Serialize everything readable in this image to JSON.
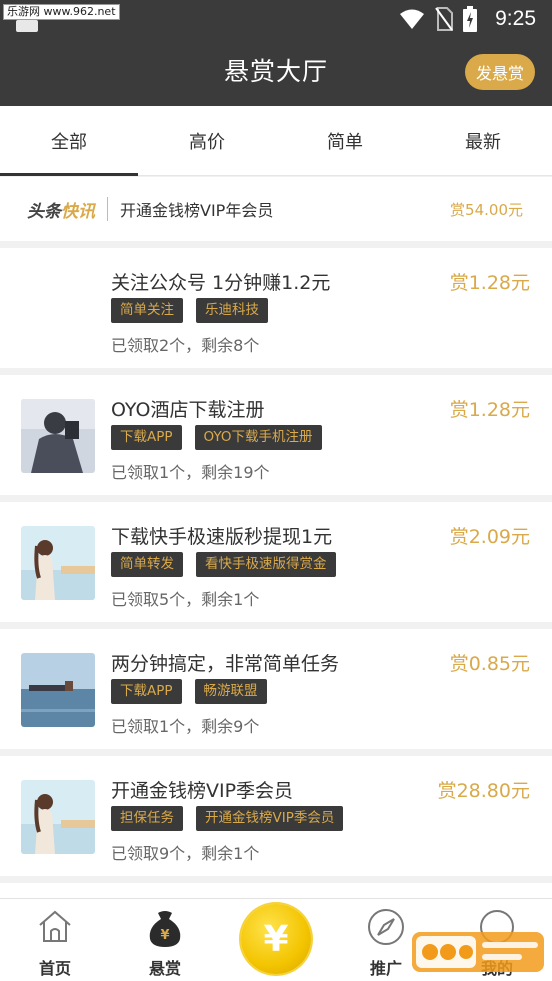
{
  "status_bar": {
    "watermark": "乐游网 www.962.net",
    "time": "9:25"
  },
  "header": {
    "title": "悬赏大厅",
    "post_button": "发悬赏"
  },
  "tabs": [
    {
      "label": "全部",
      "active": true
    },
    {
      "label": "高价",
      "active": false
    },
    {
      "label": "简单",
      "active": false
    },
    {
      "label": "最新",
      "active": false
    }
  ],
  "headline": {
    "logo_part1": "头条",
    "logo_part2": "快讯",
    "text": "开通金钱榜VIP年会员",
    "reward": "赏54.00元"
  },
  "tasks": [
    {
      "title": "关注公众号 1分钟赚1.2元",
      "reward": "赏1.28元",
      "tags": [
        "简单关注",
        "乐迪科技"
      ],
      "status": "已领取2个，剩余8个",
      "thumb": "none"
    },
    {
      "title": "OYO酒店下载注册",
      "reward": "赏1.28元",
      "tags": [
        "下载APP",
        "OYO下载手机注册"
      ],
      "status": "已领取1个，剩余19个",
      "thumb": "person"
    },
    {
      "title": "下载快手极速版秒提现1元",
      "reward": "赏2.09元",
      "tags": [
        "简单转发",
        "看快手极速版得赏金"
      ],
      "status": "已领取5个，剩余1个",
      "thumb": "girl"
    },
    {
      "title": "两分钟搞定，非常简单任务",
      "reward": "赏0.85元",
      "tags": [
        "下载APP",
        "畅游联盟"
      ],
      "status": "已领取1个，剩余9个",
      "thumb": "sea"
    },
    {
      "title": "开通金钱榜VIP季会员",
      "reward": "赏28.80元",
      "tags": [
        "担保任务",
        "开通金钱榜VIP季会员"
      ],
      "status": "已领取9个，剩余1个",
      "thumb": "girl"
    }
  ],
  "bottom_nav": {
    "home": "首页",
    "bounty": "悬赏",
    "coin_symbol": "¥",
    "promote": "推广",
    "mine": "我的",
    "bounty_bag_symbol": "¥"
  },
  "colors": {
    "accent": "#d9a94a",
    "header_bg": "#3b3b3b",
    "tag_bg": "#3a3a3a"
  },
  "icons": [
    "wifi-icon",
    "no-sim-icon",
    "battery-charging-icon",
    "home-icon",
    "money-bag-icon",
    "coin-icon",
    "compass-icon",
    "profile-icon"
  ]
}
